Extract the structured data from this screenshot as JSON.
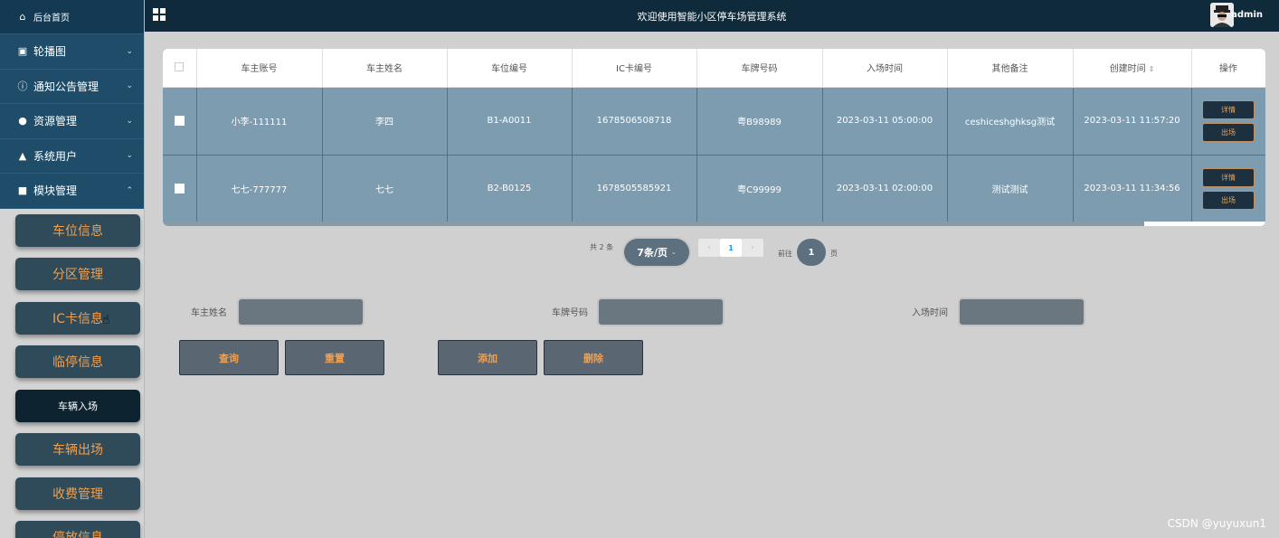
{
  "header": {
    "title": "欢迎使用智能小区停车场管理系统",
    "username": "admin"
  },
  "sidebar": {
    "home": "后台首页",
    "menus": [
      {
        "label": "轮播图",
        "icon": "image-icon",
        "glyph": "▣",
        "chevron": "⌄"
      },
      {
        "label": "通知公告管理",
        "icon": "info-icon",
        "glyph": "ⓘ",
        "chevron": "⌄"
      },
      {
        "label": "资源管理",
        "icon": "location-pin-icon",
        "glyph": "●",
        "chevron": "⌄"
      },
      {
        "label": "系统用户",
        "icon": "user-icon",
        "glyph": "▲",
        "chevron": "⌄"
      },
      {
        "label": "模块管理",
        "icon": "grid-icon",
        "glyph": "■",
        "chevron": "⌃"
      }
    ],
    "sub_items": [
      "车位信息",
      "分区管理",
      "IC卡信息",
      "临停信息",
      "车辆入场",
      "车辆出场",
      "收费管理",
      "停放信息"
    ],
    "active_sub": "车辆入场"
  },
  "table": {
    "columns": [
      "车主账号",
      "车主姓名",
      "车位编号",
      "IC卡编号",
      "车牌号码",
      "入场时间",
      "其他备注",
      "创建时间",
      "操作"
    ],
    "rows": [
      [
        "小李-111111",
        "李四",
        "B1-A0011",
        "1678506508718",
        "粤B98989",
        "2023-03-11 05:00:00",
        "ceshiceshghksg测试",
        "2023-03-11 11:57:20"
      ],
      [
        "七七-777777",
        "七七",
        "B2-B0125",
        "1678505585921",
        "粤C99999",
        "2023-03-11 02:00:00",
        "测试测试",
        "2023-03-11 11:34:56"
      ]
    ],
    "detail_label": "详情",
    "exit_label": "出场",
    "scroll_fraction": 0.89
  },
  "pagination": {
    "total": "共 2 条",
    "page_size": "7条/页",
    "prev": "‹",
    "current_page": "1",
    "next": "›",
    "goto_prefix": "前往",
    "goto_value": "1",
    "goto_suffix": "页"
  },
  "search": {
    "owner_name_label": "车主姓名",
    "plate_label": "车牌号码",
    "entry_time_label": "入场时间"
  },
  "actions": {
    "query": "查询",
    "reset": "重置",
    "add": "添加",
    "delete": "删除"
  },
  "watermark": "CSDN @yuyuxun1",
  "colors": {
    "topbar": "#0e2a3b",
    "sidebar_menu": "#1f4c68",
    "row_bg": "#7d9cb0",
    "accent_orange": "#f0a050"
  }
}
